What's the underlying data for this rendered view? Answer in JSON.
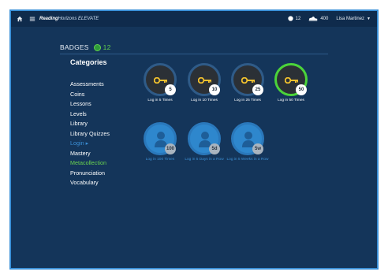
{
  "topbar": {
    "brand_bold": "Reading",
    "brand_rest": "Horizons ELEVATE",
    "coins_count": "12",
    "points_count": "400",
    "user_name": "Lisa Martinez"
  },
  "badges_header": {
    "title": "BADGES",
    "count": "12"
  },
  "categories": {
    "title": "Categories",
    "items": [
      {
        "label": "Assessments"
      },
      {
        "label": "Coins"
      },
      {
        "label": "Lessons"
      },
      {
        "label": "Levels"
      },
      {
        "label": "Library"
      },
      {
        "label": "Library Quizzes"
      },
      {
        "label": "Login ▸"
      },
      {
        "label": "Mastery"
      },
      {
        "label": "Metacollection"
      },
      {
        "label": "Pronunciation"
      },
      {
        "label": "Vocabulary"
      }
    ],
    "active_index": 6,
    "highlight_index": 8
  },
  "badges": [
    {
      "count": "5",
      "label": "Log in 5 Times",
      "state": "earned"
    },
    {
      "count": "10",
      "label": "Log in 10 Times",
      "state": "earned"
    },
    {
      "count": "25",
      "label": "Log in 25 Times",
      "state": "earned"
    },
    {
      "count": "50",
      "label": "Log in 50 Times",
      "state": "earned-highlight"
    },
    {
      "count": "100",
      "label": "Log in 100 Times",
      "state": "locked"
    },
    {
      "count": "5d",
      "label": "Log in 5 Days in a Row",
      "state": "locked"
    },
    {
      "count": "5w",
      "label": "Log in 5 Weeks in a Row",
      "state": "locked"
    }
  ],
  "colors": {
    "background": "#14355a",
    "accent_green": "#63d14e",
    "accent_blue": "#3b8fd6",
    "key_yellow": "#f2c12e"
  },
  "icons": {
    "home": "home-icon",
    "menu": "hamburger-menu-icon",
    "coin": "coin-icon",
    "points": "sneaker-icon",
    "caret": "caret-down-icon"
  }
}
